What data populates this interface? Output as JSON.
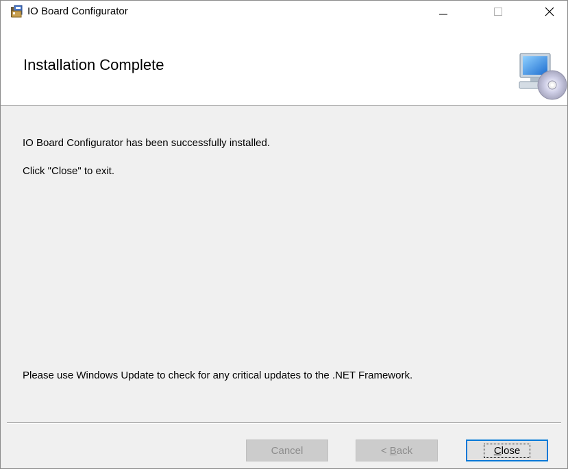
{
  "window": {
    "title": "IO Board Configurator",
    "icons": {
      "app": "installer-app-icon",
      "banner": "computer-cd-icon"
    }
  },
  "titlebar_buttons": {
    "minimize": "minimize-icon",
    "maximize": "maximize-icon",
    "close": "close-icon"
  },
  "banner": {
    "title": "Installation Complete"
  },
  "body": {
    "message1": "IO Board Configurator has been successfully installed.",
    "message2": "Click \"Close\" to exit.",
    "message3": "Please use Windows Update to check for any critical updates to the .NET Framework."
  },
  "buttons": {
    "cancel": {
      "label": "Cancel",
      "enabled": false
    },
    "back": {
      "prefix": "< ",
      "mnemonic": "B",
      "rest": "ack",
      "enabled": false
    },
    "close": {
      "mnemonic": "C",
      "rest": "lose",
      "enabled": true,
      "default": true
    }
  },
  "colors": {
    "focus_border": "#0078d7",
    "background": "#f0f0f0",
    "banner": "#ffffff"
  }
}
